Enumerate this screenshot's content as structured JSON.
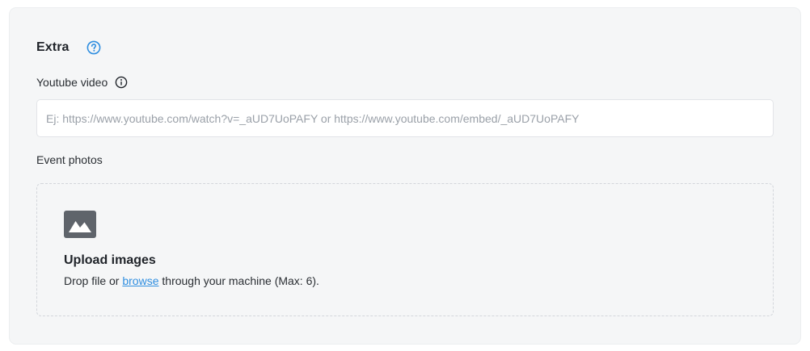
{
  "section": {
    "title": "Extra"
  },
  "youtube": {
    "label": "Youtube video",
    "value": "",
    "placeholder": "Ej: https://www.youtube.com/watch?v=_aUD7UoPAFY or https://www.youtube.com/embed/_aUD7UoPAFY"
  },
  "photos": {
    "label": "Event photos",
    "upload_title": "Upload images",
    "desc_prefix": "Drop file or ",
    "browse_label": "browse",
    "desc_suffix": " through your machine (Max: 6)."
  },
  "icons": {
    "help": "question-circle-icon",
    "info": "info-circle-icon",
    "upload": "image-icon"
  },
  "colors": {
    "accent": "#2f8ee0",
    "card_background": "#f5f6f7",
    "icon_gray": "#5f646b"
  }
}
